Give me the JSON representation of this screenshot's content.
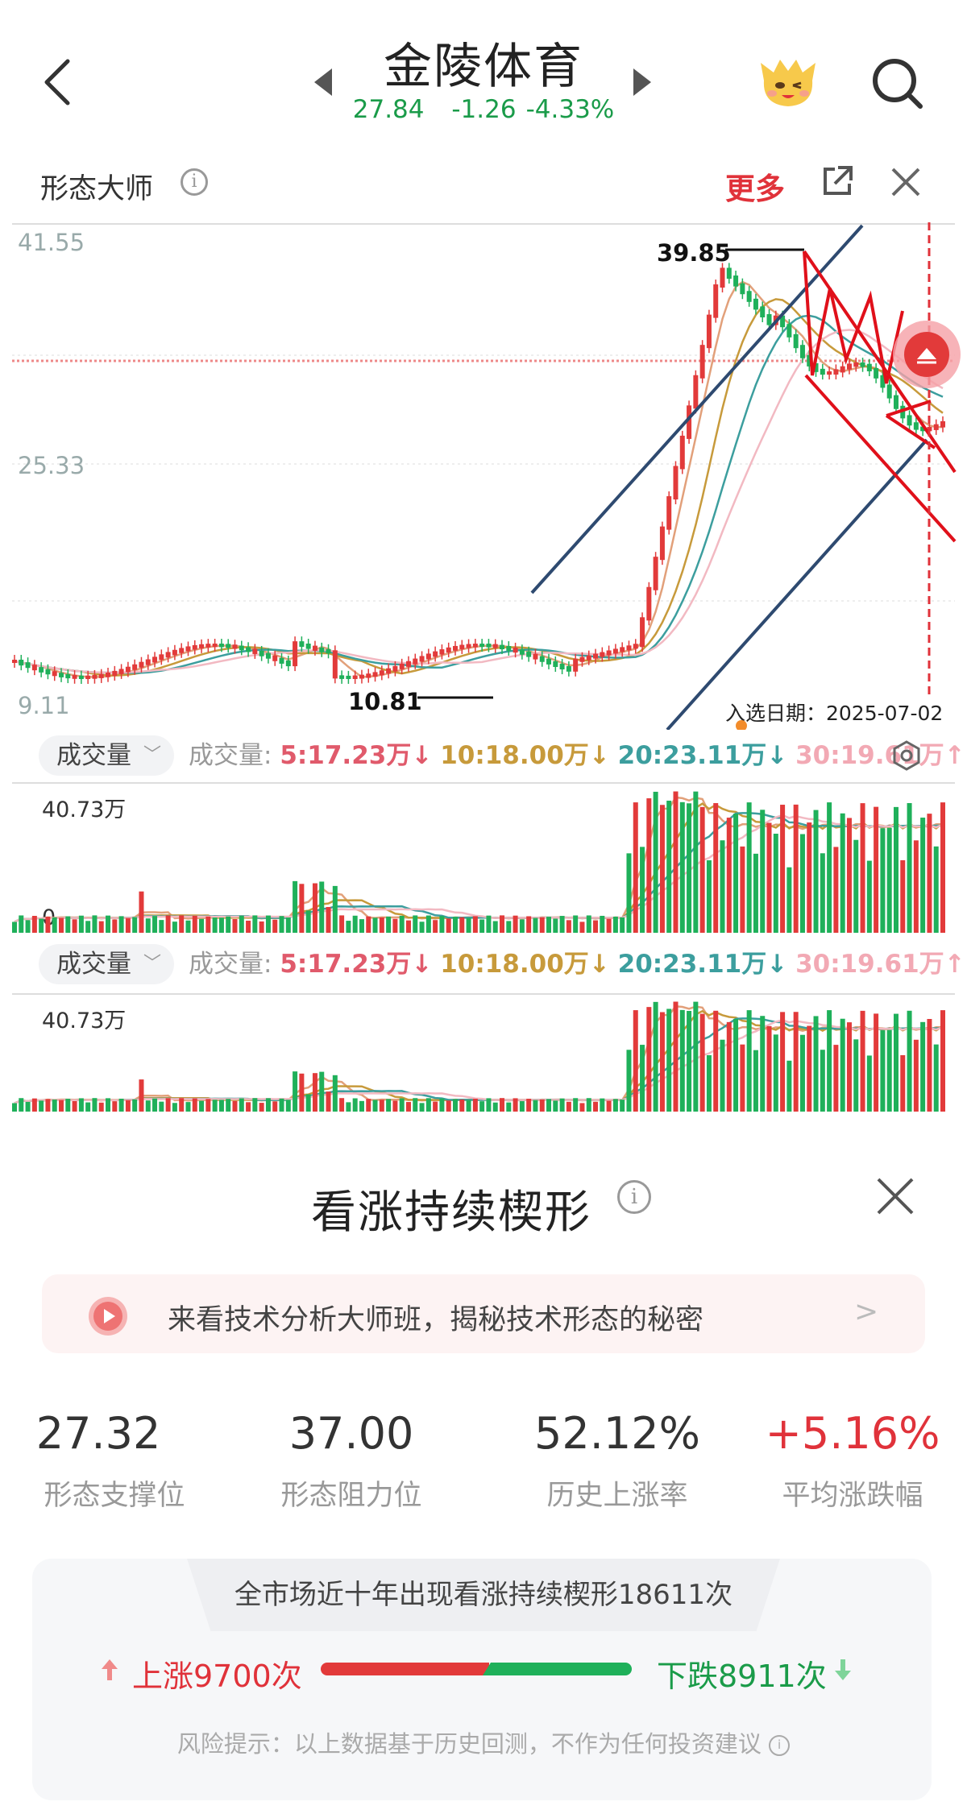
{
  "header": {
    "title": "金陵体育",
    "price": "27.84",
    "change": "-1.26",
    "change_pct": "-4.33%"
  },
  "toolbar": {
    "title": "形态大师",
    "more_label": "更多"
  },
  "chart": {
    "price_axis": {
      "top": "41.55",
      "mid": "25.33",
      "bottom": "9.11"
    },
    "high_label": "39.85",
    "low_label": "10.81",
    "selected_date_label": "入选日期：2025-07-02",
    "colors": {
      "up": "#e23a3a",
      "down": "#1fb05a",
      "pattern_line": "#e0101a",
      "channel_line": "#2e4a70"
    }
  },
  "volume_panels": [
    {
      "pill": "成交量",
      "label": "成交量:",
      "ma5": "5:17.23万",
      "ma10": "10:18.00万",
      "ma20": "20:23.11万",
      "ma30": "30:19.61万",
      "ma5_arrow": "↓",
      "ma10_arrow": "↓",
      "ma20_arrow": "↓",
      "ma30_arrow": "↑",
      "max_label": "40.73万",
      "zero_label": "0"
    },
    {
      "pill": "成交量",
      "label": "成交量:",
      "ma5": "5:17.23万",
      "ma10": "10:18.00万",
      "ma20": "20:23.11万",
      "ma30": "30:19.61万",
      "ma5_arrow": "↓",
      "ma10_arrow": "↓",
      "ma20_arrow": "↓",
      "ma30_arrow": "↑",
      "max_label": "40.73万"
    }
  ],
  "panel": {
    "title": "看涨持续楔形",
    "banner_text": "来看技术分析大师班，揭秘技术形态的秘密",
    "stats": [
      {
        "value": "27.32",
        "label": "形态支撑位",
        "color": "#333333"
      },
      {
        "value": "37.00",
        "label": "形态阻力位",
        "color": "#333333"
      },
      {
        "value": "52.12%",
        "label": "历史上涨率",
        "color": "#333333"
      },
      {
        "value": "+5.16%",
        "label": "平均涨跌幅",
        "color": "#e0323a"
      }
    ],
    "count_heading": "全市场近十年出现看涨持续楔形18611次",
    "up_text": "上涨9700次",
    "down_text": "下跌8911次",
    "up_count": 9700,
    "down_count": 8911,
    "risk_note": "风险提示：以上数据基于历史回测，不作为任何投资建议"
  }
}
